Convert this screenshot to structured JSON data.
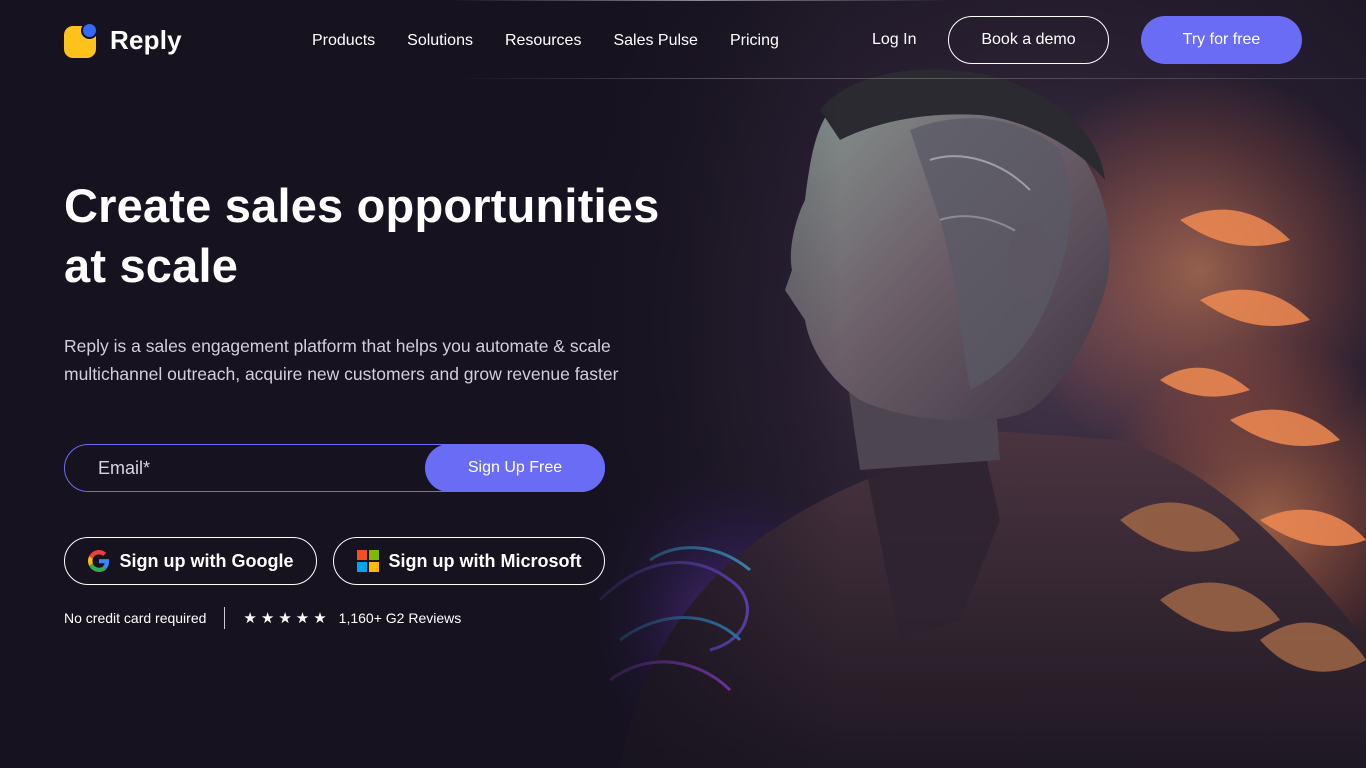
{
  "brand": {
    "name": "Reply",
    "logo_colors": {
      "square": "#ffc21a",
      "dot": "#3369ff"
    }
  },
  "nav": {
    "items": [
      {
        "label": "Products"
      },
      {
        "label": "Solutions"
      },
      {
        "label": "Resources"
      },
      {
        "label": "Sales Pulse"
      },
      {
        "label": "Pricing"
      }
    ],
    "login_label": "Log In",
    "demo_label": "Book a demo",
    "try_label": "Try for free"
  },
  "hero": {
    "title": "Create sales opportunities at scale",
    "subtitle": "Reply is a sales engagement platform that helps you automate & scale multichannel outreach, acquire new customers and grow revenue faster",
    "email_placeholder": "Email*",
    "signup_label": "Sign Up Free",
    "google_label": "Sign up with Google",
    "microsoft_label": "Sign up with Microsoft",
    "no_card_text": "No credit card required",
    "rating_stars": 5,
    "reviews_text": "1,160+ G2 Reviews"
  },
  "colors": {
    "background": "#16121f",
    "accent": "#6b6cf6",
    "text": "#ffffff",
    "muted_text": "#d2cfdc"
  },
  "icons": [
    "google-icon",
    "microsoft-icon",
    "star-icon"
  ]
}
